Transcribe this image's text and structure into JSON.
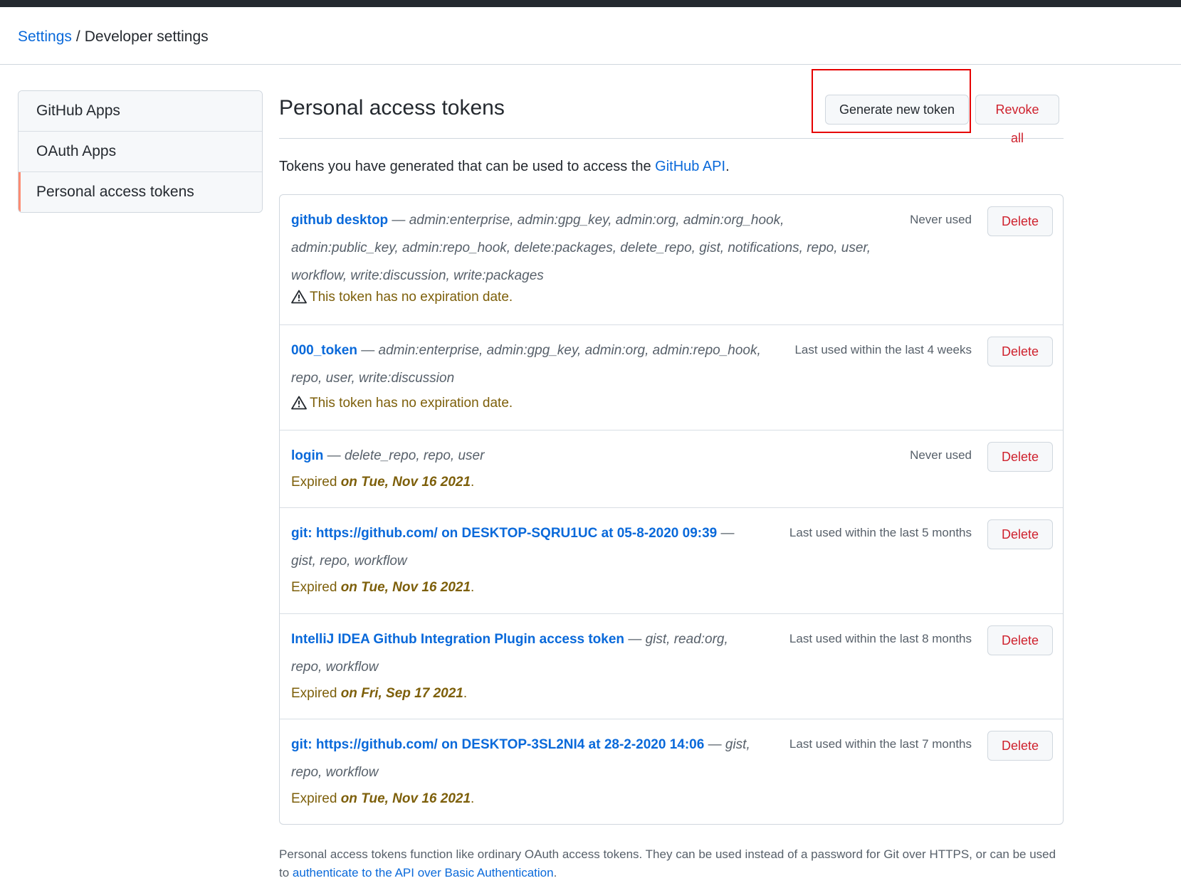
{
  "breadcrumb": {
    "parent": "Settings",
    "separator": "/",
    "current": "Developer settings"
  },
  "sidebar": {
    "items": [
      {
        "label": "GitHub Apps"
      },
      {
        "label": "OAuth Apps"
      },
      {
        "label": "Personal access tokens",
        "selected": true
      }
    ]
  },
  "header": {
    "title": "Personal access tokens",
    "generate_label": "Generate new token",
    "revoke_label": "Revoke all"
  },
  "intro": {
    "text": "Tokens you have generated that can be used to access the ",
    "link": "GitHub API",
    "end": "."
  },
  "tokens": [
    {
      "name": "github desktop",
      "dash": " — ",
      "scopes": "admin:enterprise, admin:gpg_key, admin:org, admin:org_hook, admin:public_key, admin:repo_hook, delete:packages, delete_repo, gist, notifications, repo, user, workflow, write:discussion, write:packages",
      "usage": "Never used",
      "warning": "This token has no expiration date.",
      "delete_label": "Delete"
    },
    {
      "name": "000_token",
      "dash": " — ",
      "scopes": "admin:enterprise, admin:gpg_key, admin:org, admin:repo_hook, repo, user, write:discussion",
      "usage": "Last used within the last 4 weeks",
      "warning": "This token has no expiration date.",
      "delete_label": "Delete"
    },
    {
      "name": "login",
      "dash": " — ",
      "scopes": "delete_repo, repo, user",
      "usage": "Never used",
      "expired_prefix": "Expired ",
      "expired_date": "on Tue, Nov 16 2021",
      "expired_suffix": ".",
      "delete_label": "Delete"
    },
    {
      "name": "git: https://github.com/ on DESKTOP-SQRU1UC at 05-8-2020 09:39",
      "dash": " — ",
      "scopes": "gist, repo, workflow",
      "usage": "Last used within the last 5 months",
      "expired_prefix": "Expired ",
      "expired_date": "on Tue, Nov 16 2021",
      "expired_suffix": ".",
      "delete_label": "Delete"
    },
    {
      "name": "IntelliJ IDEA Github Integration Plugin access token",
      "dash": " — ",
      "scopes": "gist, read:org, repo, workflow",
      "usage": "Last used within the last 8 months",
      "expired_prefix": "Expired ",
      "expired_date": "on Fri, Sep 17 2021",
      "expired_suffix": ".",
      "delete_label": "Delete"
    },
    {
      "name": "git: https://github.com/ on DESKTOP-3SL2NI4 at 28-2-2020 14:06",
      "dash": " — ",
      "scopes": "gist, repo, workflow",
      "usage": "Last used within the last 7 months",
      "expired_prefix": "Expired ",
      "expired_date": "on Tue, Nov 16 2021",
      "expired_suffix": ".",
      "delete_label": "Delete"
    }
  ],
  "footer": {
    "text": "Personal access tokens function like ordinary OAuth access tokens. They can be used instead of a password for Git over HTTPS, or can be used to ",
    "link": "authenticate to the API over Basic Authentication",
    "end": "."
  },
  "colors": {
    "link": "#0969da",
    "danger": "#cf222e",
    "warning": "#7d5f0a",
    "selected_marker": "#fd8c73",
    "highlight_box": "#e60000"
  },
  "icons": [
    "alert-triangle-icon"
  ]
}
